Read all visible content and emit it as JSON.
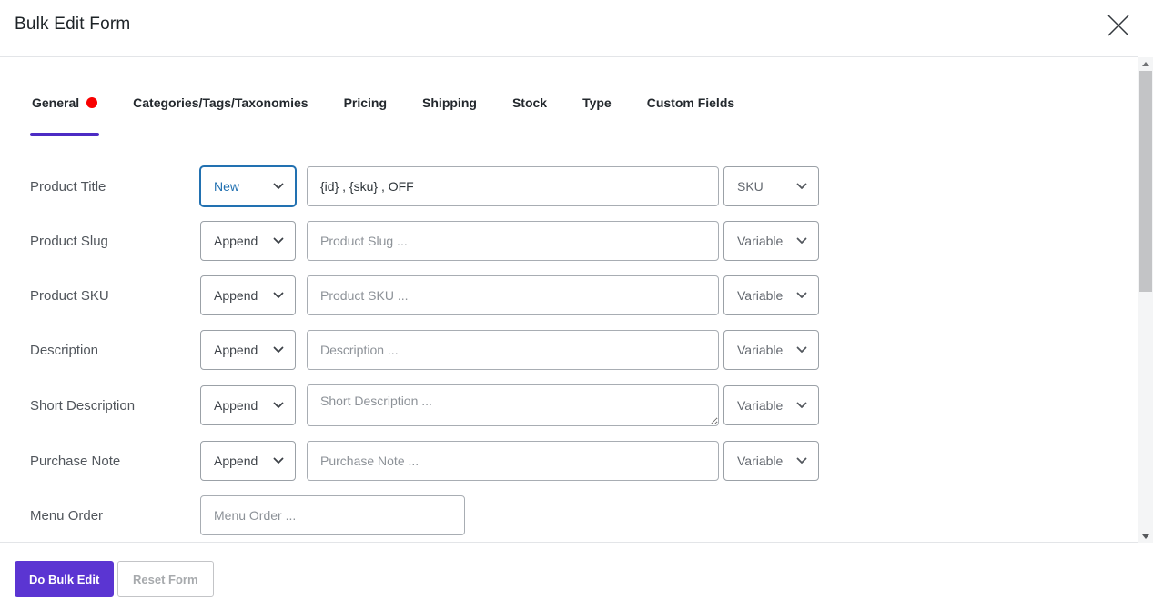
{
  "modal": {
    "title": "Bulk Edit Form"
  },
  "tabs": [
    {
      "label": "General",
      "active": true,
      "has_alert_dot": true
    },
    {
      "label": "Categories/Tags/Taxonomies",
      "active": false
    },
    {
      "label": "Pricing",
      "active": false
    },
    {
      "label": "Shipping",
      "active": false
    },
    {
      "label": "Stock",
      "active": false
    },
    {
      "label": "Type",
      "active": false
    },
    {
      "label": "Custom Fields",
      "active": false
    }
  ],
  "form": {
    "rows": [
      {
        "label": "Product Title",
        "mode": "New",
        "value": "{id} , {sku} , OFF",
        "variable": "SKU",
        "mode_focused": true
      },
      {
        "label": "Product Slug",
        "mode": "Append",
        "placeholder": "Product Slug ...",
        "variable": "Variable"
      },
      {
        "label": "Product SKU",
        "mode": "Append",
        "placeholder": "Product SKU ...",
        "variable": "Variable"
      },
      {
        "label": "Description",
        "mode": "Append",
        "placeholder": "Description ...",
        "variable": "Variable"
      },
      {
        "label": "Short Description",
        "mode": "Append",
        "placeholder": "Short Description ...",
        "variable": "Variable",
        "multiline": true
      },
      {
        "label": "Purchase Note",
        "mode": "Append",
        "placeholder": "Purchase Note ...",
        "variable": "Variable"
      },
      {
        "label": "Menu Order",
        "placeholder": "Menu Order ..."
      }
    ]
  },
  "footer": {
    "submit_label": "Do Bulk Edit",
    "reset_label": "Reset Form"
  },
  "icons": {
    "close": "close-icon",
    "select_caret": "chevron-down-icon",
    "scroll_up": "scroll-up-arrow-icon",
    "scroll_down": "scroll-down-arrow-icon"
  },
  "colors": {
    "accent-purple": "#5b35d2",
    "tab-underline-purple": "#4c2bc4",
    "focus-blue": "#2271b1",
    "alert-red": "#f80000"
  }
}
